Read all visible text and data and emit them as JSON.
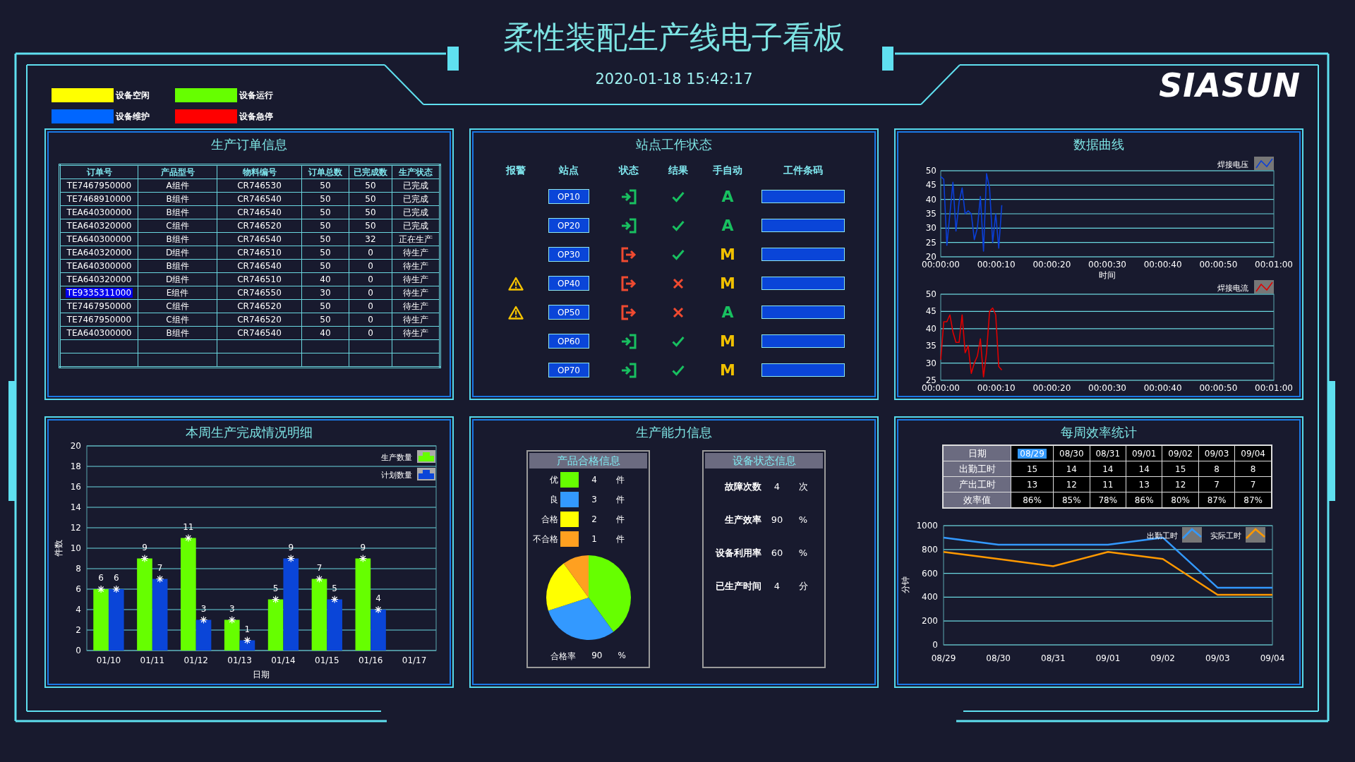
{
  "header": {
    "title": "柔性装配生产线电子看板",
    "datetime": "2020-01-18 15:42:17",
    "logo": "SIASUN"
  },
  "legend": [
    {
      "label": "设备空闲",
      "color": "#ffff00"
    },
    {
      "label": "设备运行",
      "color": "#66ff00"
    },
    {
      "label": "设备维护",
      "color": "#0066ff"
    },
    {
      "label": "设备急停",
      "color": "#ff0000"
    }
  ],
  "orders": {
    "title": "生产订单信息",
    "columns": [
      "订单号",
      "产品型号",
      "物料编号",
      "订单总数",
      "已完成数",
      "生产状态"
    ],
    "rows": [
      {
        "cells": [
          "TE7467950000",
          "A组件",
          "CR746530",
          "50",
          "50",
          "已完成"
        ],
        "selected": false
      },
      {
        "cells": [
          "TE7468910000",
          "B组件",
          "CR746540",
          "50",
          "50",
          "已完成"
        ],
        "selected": false
      },
      {
        "cells": [
          "TEA640300000",
          "B组件",
          "CR746540",
          "50",
          "50",
          "已完成"
        ],
        "selected": false
      },
      {
        "cells": [
          "TEA640320000",
          "C组件",
          "CR746520",
          "50",
          "50",
          "已完成"
        ],
        "selected": false
      },
      {
        "cells": [
          "TEA640300000",
          "B组件",
          "CR746540",
          "50",
          "32",
          "正在生产"
        ],
        "selected": false
      },
      {
        "cells": [
          "TEA640320000",
          "D组件",
          "CR746510",
          "50",
          "0",
          "待生产"
        ],
        "selected": false
      },
      {
        "cells": [
          "TEA640300000",
          "B组件",
          "CR746540",
          "50",
          "0",
          "待生产"
        ],
        "selected": false
      },
      {
        "cells": [
          "TEA640320000",
          "D组件",
          "CR746510",
          "40",
          "0",
          "待生产"
        ],
        "selected": false
      },
      {
        "cells": [
          "TE9335311000",
          "E组件",
          "CR746550",
          "30",
          "0",
          "待生产"
        ],
        "selected": true
      },
      {
        "cells": [
          "TE7467950000",
          "C组件",
          "CR746520",
          "50",
          "0",
          "待生产"
        ],
        "selected": false
      },
      {
        "cells": [
          "TE7467950000",
          "C组件",
          "CR746520",
          "50",
          "0",
          "待生产"
        ],
        "selected": false
      },
      {
        "cells": [
          "TEA640300000",
          "B组件",
          "CR746540",
          "40",
          "0",
          "待生产"
        ],
        "selected": false
      }
    ]
  },
  "stations": {
    "title": "站点工作状态",
    "columns": [
      "报警",
      "站点",
      "状态",
      "结果",
      "手自动",
      "工件条码"
    ],
    "rows": [
      {
        "alarm": false,
        "station": "OP10",
        "entered": true,
        "passed": true,
        "mode": "A",
        "auto": true
      },
      {
        "alarm": false,
        "station": "OP20",
        "entered": true,
        "passed": true,
        "mode": "A",
        "auto": true
      },
      {
        "alarm": false,
        "station": "OP30",
        "entered": false,
        "passed": true,
        "mode": "M",
        "auto": false
      },
      {
        "alarm": true,
        "station": "OP40",
        "entered": false,
        "passed": false,
        "mode": "M",
        "auto": false
      },
      {
        "alarm": true,
        "station": "OP50",
        "entered": false,
        "passed": false,
        "mode": "A",
        "auto": true
      },
      {
        "alarm": false,
        "station": "OP60",
        "entered": true,
        "passed": true,
        "mode": "M",
        "auto": false
      },
      {
        "alarm": false,
        "station": "OP70",
        "entered": true,
        "passed": true,
        "mode": "M",
        "auto": false
      }
    ]
  },
  "curves": {
    "title": "数据曲线",
    "charts": [
      {
        "chart_data": {
          "type": "line",
          "xlabel": "时间",
          "x": [
            0,
            0.55,
            1.1,
            1.65,
            2.2,
            2.75,
            3.3,
            3.85,
            4.4,
            4.95,
            5.5,
            6.05,
            6.6,
            7.15,
            7.7,
            8.25,
            8.8,
            9.35,
            9.9,
            10.45,
            11
          ],
          "series": [
            {
              "name": "焊接电压",
              "color": "#0a3fd8",
              "values": [
                48,
                47,
                24,
                35,
                46,
                29,
                39,
                44,
                35,
                36,
                35,
                26,
                30,
                41,
                22,
                49,
                44,
                25,
                35,
                23,
                38
              ]
            }
          ],
          "xlim": [
            0,
            60
          ],
          "ylim": [
            20,
            50
          ],
          "xticks": [
            {
              "value": 0,
              "label": "00:00:00"
            },
            {
              "value": 10,
              "label": "00:00:10"
            },
            {
              "value": 20,
              "label": "00:00:20"
            },
            {
              "value": 30,
              "label": "00:00:30"
            },
            {
              "value": 40,
              "label": "00:00:40"
            },
            {
              "value": 50,
              "label": "00:00:50"
            },
            {
              "value": 60,
              "label": "00:01:00"
            }
          ],
          "yticks": [
            20,
            25,
            30,
            35,
            40,
            45,
            50
          ],
          "grid": true,
          "legend": "upper right"
        }
      },
      {
        "chart_data": {
          "type": "line",
          "x": [
            0,
            0.55,
            1.1,
            1.65,
            2.2,
            2.75,
            3.3,
            3.85,
            4.4,
            4.95,
            5.5,
            6.05,
            6.6,
            7.15,
            7.7,
            8.25,
            8.8,
            9.35,
            9.9,
            10.45,
            11
          ],
          "series": [
            {
              "name": "焊接电流",
              "color": "#e00000",
              "values": [
                31,
                42,
                42,
                44,
                39,
                36,
                36,
                44,
                33,
                35,
                27,
                30,
                32,
                37,
                26,
                33,
                45,
                46,
                44,
                29,
                28
              ]
            }
          ],
          "xlim": [
            0,
            60
          ],
          "ylim": [
            25,
            50
          ],
          "xticks": [
            {
              "value": 0,
              "label": "00:00:00"
            },
            {
              "value": 10,
              "label": "00:00:10"
            },
            {
              "value": 20,
              "label": "00:00:20"
            },
            {
              "value": 30,
              "label": "00:00:30"
            },
            {
              "value": 40,
              "label": "00:00:40"
            },
            {
              "value": 50,
              "label": "00:00:50"
            },
            {
              "value": 60,
              "label": "00:01:00"
            }
          ],
          "yticks": [
            25,
            30,
            35,
            40,
            45,
            50
          ],
          "grid": true,
          "legend": "upper right"
        }
      }
    ]
  },
  "weekly": {
    "chart_data": {
      "type": "bar",
      "title": "本周生产完成情况明细",
      "xlabel": "日期",
      "ylabel": "件数",
      "categories": [
        "01/10",
        "01/11",
        "01/12",
        "01/13",
        "01/14",
        "01/15",
        "01/16",
        "01/17"
      ],
      "series": [
        {
          "name": "生产数量",
          "color": "#66ff00",
          "values": [
            6,
            9,
            11,
            3,
            5,
            7,
            9,
            null
          ]
        },
        {
          "name": "计划数量",
          "color": "#0a45d8",
          "values": [
            6,
            7,
            3,
            1,
            9,
            5,
            4,
            null
          ]
        }
      ],
      "ylim": [
        0,
        20
      ],
      "yticks": [
        0,
        2,
        4,
        6,
        8,
        10,
        12,
        14,
        16,
        18,
        20
      ],
      "data_labels": true,
      "grid": true,
      "legend": "upper right"
    }
  },
  "capacity": {
    "title": "生产能力信息",
    "quality": {
      "title": "产品合格信息",
      "chart_data": {
        "type": "pie",
        "categories": [
          "优",
          "良",
          "合格",
          "不合格"
        ],
        "values": [
          40,
          30,
          20,
          10
        ]
      },
      "grades": [
        {
          "color": "#66ff00",
          "count": "4",
          "unit": "件"
        },
        {
          "color": "#3399ff",
          "count": "3",
          "unit": "件"
        },
        {
          "color": "#ffff00",
          "count": "2",
          "unit": "件"
        },
        {
          "color": "#ffa020",
          "count": "1",
          "unit": "件"
        }
      ],
      "rate_label": "合格率",
      "rate_value": "90",
      "rate_unit": "%"
    },
    "equipment": {
      "title": "设备状态信息",
      "items": [
        {
          "label": "故障次数",
          "value": "4",
          "unit": "次"
        },
        {
          "label": "生产效率",
          "value": "90",
          "unit": "%"
        },
        {
          "label": "设备利用率",
          "value": "60",
          "unit": "%"
        },
        {
          "label": "已生产时间",
          "value": "4",
          "unit": "分"
        }
      ]
    }
  },
  "efficiency": {
    "title": "每周效率统计",
    "table": {
      "header_label": "日期",
      "dates": [
        {
          "text": "08/29",
          "selected": true
        },
        {
          "text": "08/30",
          "selected": false
        },
        {
          "text": "08/31",
          "selected": false
        },
        {
          "text": "09/01",
          "selected": false
        },
        {
          "text": "09/02",
          "selected": false
        },
        {
          "text": "09/03",
          "selected": false
        },
        {
          "text": "09/04",
          "selected": false
        }
      ],
      "rows": [
        {
          "label": "出勤工时",
          "values": [
            "15",
            "14",
            "14",
            "14",
            "15",
            "8",
            "8"
          ]
        },
        {
          "label": "产出工时",
          "values": [
            "13",
            "12",
            "11",
            "13",
            "12",
            "7",
            "7"
          ]
        },
        {
          "label": "效率值",
          "values": [
            "86%",
            "85%",
            "78%",
            "86%",
            "80%",
            "87%",
            "87%"
          ]
        }
      ]
    },
    "chart_data": {
      "type": "line",
      "ylabel": "分钟",
      "categories": [
        "08/29",
        "08/30",
        "08/31",
        "09/01",
        "09/02",
        "09/03",
        "09/04"
      ],
      "series": [
        {
          "name": "出勤工时",
          "color": "#3399ff",
          "values": [
            900,
            840,
            840,
            840,
            900,
            480,
            480
          ]
        },
        {
          "name": "实际工时",
          "color": "#ff9900",
          "values": [
            780,
            720,
            660,
            780,
            720,
            420,
            420
          ]
        }
      ],
      "ylim": [
        0,
        1000
      ],
      "yticks": [
        0,
        200,
        400,
        600,
        800,
        1000
      ],
      "grid": true,
      "legend": "upper right"
    }
  }
}
